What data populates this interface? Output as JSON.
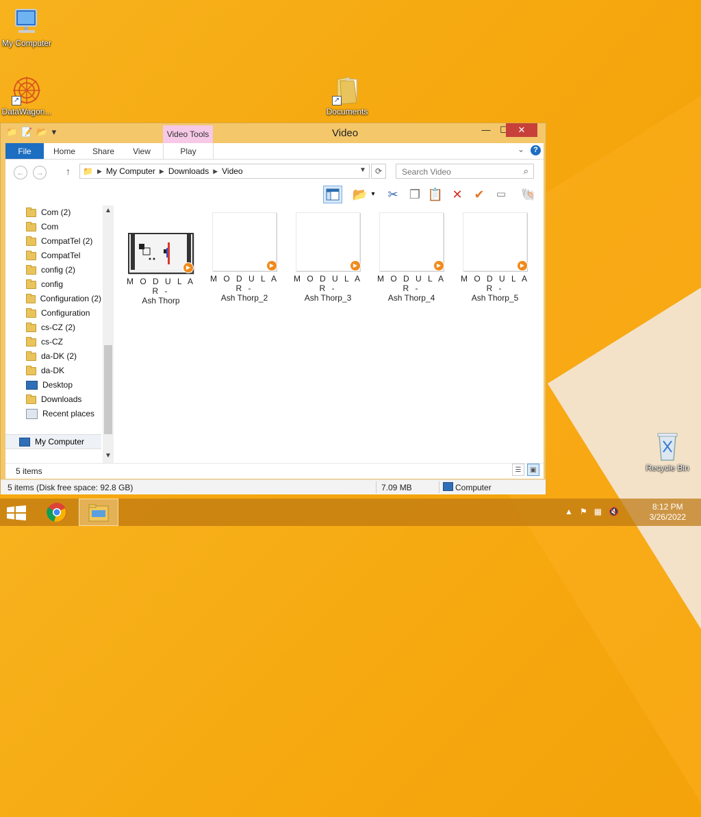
{
  "desktop": {
    "icons": [
      {
        "label": "My Computer"
      },
      {
        "label": "DataWagon..."
      },
      {
        "label": "Documents"
      },
      {
        "label": "Recycle Bin"
      }
    ]
  },
  "window": {
    "title": "Video",
    "contextual_tab": "Video Tools",
    "controls": {
      "minimize": "—",
      "maximize": "☐",
      "close": "✕"
    }
  },
  "ribbon": {
    "tabs": [
      "File",
      "Home",
      "Share",
      "View",
      "Play"
    ],
    "help": "?"
  },
  "address": {
    "crumbs": [
      "My Computer",
      "Downloads",
      "Video"
    ]
  },
  "search": {
    "placeholder": "Search Video"
  },
  "nav_pane": {
    "items": [
      {
        "label": "Com (2)",
        "icon": "folder"
      },
      {
        "label": "Com",
        "icon": "folder"
      },
      {
        "label": "CompatTel (2)",
        "icon": "folder"
      },
      {
        "label": "CompatTel",
        "icon": "folder"
      },
      {
        "label": "config (2)",
        "icon": "folder"
      },
      {
        "label": "config",
        "icon": "folder"
      },
      {
        "label": "Configuration (2)",
        "icon": "folder"
      },
      {
        "label": "Configuration",
        "icon": "folder"
      },
      {
        "label": "cs-CZ (2)",
        "icon": "folder"
      },
      {
        "label": "cs-CZ",
        "icon": "folder"
      },
      {
        "label": "da-DK (2)",
        "icon": "folder"
      },
      {
        "label": "da-DK",
        "icon": "folder"
      },
      {
        "label": "Desktop",
        "icon": "desktop"
      },
      {
        "label": "Downloads",
        "icon": "downloads"
      },
      {
        "label": "Recent places",
        "icon": "recent"
      }
    ],
    "root": "My Computer"
  },
  "files": [
    {
      "line1": "M O D U L A R -",
      "line2": "Ash Thorp",
      "thumb": "video"
    },
    {
      "line1": "M O D U L A R -",
      "line2": "Ash Thorp_2",
      "thumb": "blank"
    },
    {
      "line1": "M O D U L A R -",
      "line2": "Ash Thorp_3",
      "thumb": "blank"
    },
    {
      "line1": "M O D U L A R -",
      "line2": "Ash Thorp_4",
      "thumb": "blank"
    },
    {
      "line1": "M O D U L A R -",
      "line2": "Ash Thorp_5",
      "thumb": "blank"
    }
  ],
  "status": {
    "item_count": "5 items",
    "disk": "5 items (Disk free space: 92.8 GB)",
    "size": "7.09 MB",
    "location": "Computer"
  },
  "taskbar": {
    "clock_time": "8:12 PM",
    "clock_date": "3/26/2022"
  },
  "colors": {
    "accent": "#1c6ec1",
    "desktop": "#f6a80f",
    "close": "#c7403a"
  }
}
